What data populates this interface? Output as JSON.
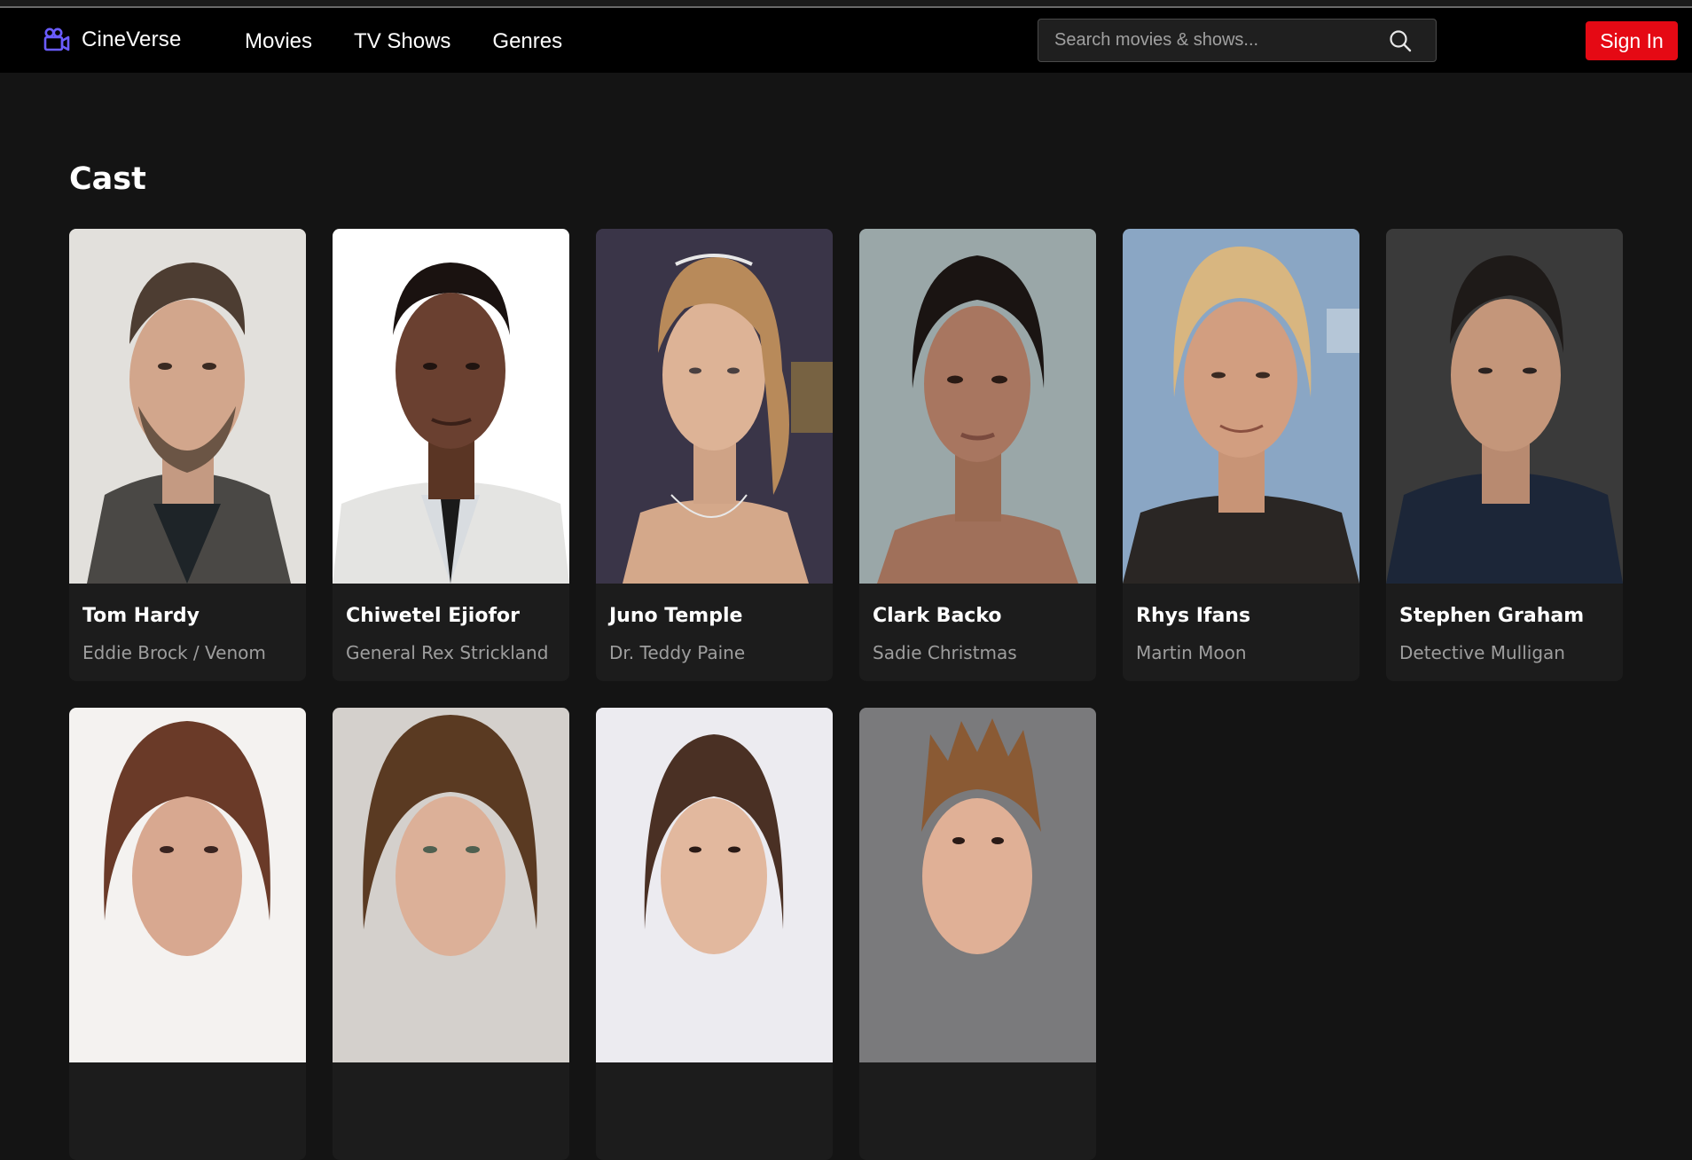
{
  "app": {
    "name": "CineVerse",
    "logo_icon": "video-camera-icon",
    "accent_color": "#6a5cff"
  },
  "nav": {
    "links": [
      {
        "label": "Movies"
      },
      {
        "label": "TV Shows"
      },
      {
        "label": "Genres"
      }
    ]
  },
  "search": {
    "placeholder": "Search movies & shows...",
    "value": "",
    "icon": "search-icon"
  },
  "auth": {
    "signin_label": "Sign In",
    "signin_color": "#e50914"
  },
  "cast_section": {
    "title": "Cast",
    "members": [
      {
        "name": "Tom Hardy",
        "role": "Eddie Brock / Venom"
      },
      {
        "name": "Chiwetel Ejiofor",
        "role": "General Rex Strickland"
      },
      {
        "name": "Juno Temple",
        "role": "Dr. Teddy Paine"
      },
      {
        "name": "Clark Backo",
        "role": "Sadie Christmas"
      },
      {
        "name": "Rhys Ifans",
        "role": "Martin Moon"
      },
      {
        "name": "Stephen Graham",
        "role": "Detective Mulligan"
      },
      {
        "name": "",
        "role": ""
      },
      {
        "name": "",
        "role": ""
      },
      {
        "name": "",
        "role": ""
      },
      {
        "name": "",
        "role": ""
      }
    ]
  }
}
